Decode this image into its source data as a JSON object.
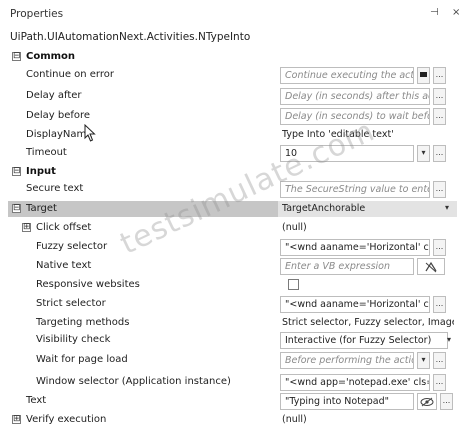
{
  "panel": {
    "title": "Properties",
    "pin_glyph": "⊣",
    "close_glyph": "×"
  },
  "activity": {
    "class_path": "UiPath.UIAutomationNext.Activities.NTypeInto"
  },
  "sections": {
    "common": {
      "label": "Common",
      "expander": "⊟"
    },
    "input": {
      "label": "Input",
      "expander": "⊟"
    }
  },
  "properties": {
    "continue_on_error": {
      "label": "Continue on error",
      "placeholder": "Continue executing the activiti"
    },
    "delay_after": {
      "label": "Delay after",
      "placeholder": "Delay (in seconds) after this activit"
    },
    "delay_before": {
      "label": "Delay before",
      "placeholder": "Delay (in seconds) to wait before e"
    },
    "display_name": {
      "label": "DisplayName",
      "value": "Type Into 'editable text'"
    },
    "timeout": {
      "label": "Timeout",
      "value": "10"
    },
    "secure_text": {
      "label": "Secure text",
      "placeholder": "The SecureString value to enter."
    },
    "target": {
      "label": "Target",
      "expander": "⊟",
      "value": "TargetAnchorable"
    },
    "click_offset": {
      "label": "Click offset",
      "expander": "⊞",
      "value": "(null)"
    },
    "fuzzy_selector": {
      "label": "Fuzzy selector",
      "value": "\"<wnd aaname='Horizontal' cls='"
    },
    "native_text": {
      "label": "Native text",
      "placeholder": "Enter a VB expression"
    },
    "responsive_websites": {
      "label": "Responsive websites"
    },
    "strict_selector": {
      "label": "Strict selector",
      "value": "\"<wnd aaname='Horizontal' cls='"
    },
    "targeting_methods": {
      "label": "Targeting methods",
      "value": "Strict selector, Fuzzy selector, Image"
    },
    "visibility_check": {
      "label": "Visibility check",
      "value": "Interactive (for Fuzzy Selector)"
    },
    "wait_for_page_load": {
      "label": "Wait for page load",
      "placeholder": "Before performing the action, wa"
    },
    "window_selector": {
      "label": "Window selector (Application instance)",
      "value": "\"<wnd app='notepad.exe' cls='No"
    },
    "text": {
      "label": "Text",
      "value": "\"Typing into Notepad\""
    },
    "verify_execution": {
      "label": "Verify execution",
      "expander": "⊞",
      "value": "(null)"
    }
  },
  "buttons": {
    "ellipsis": "...",
    "dropdown": "▾"
  },
  "watermark": {
    "text": "testsimulate.com"
  },
  "colors": {
    "selected_row": "#c6c6c6",
    "border": "#bdbdbd",
    "placeholder": "#8a8a8a"
  }
}
